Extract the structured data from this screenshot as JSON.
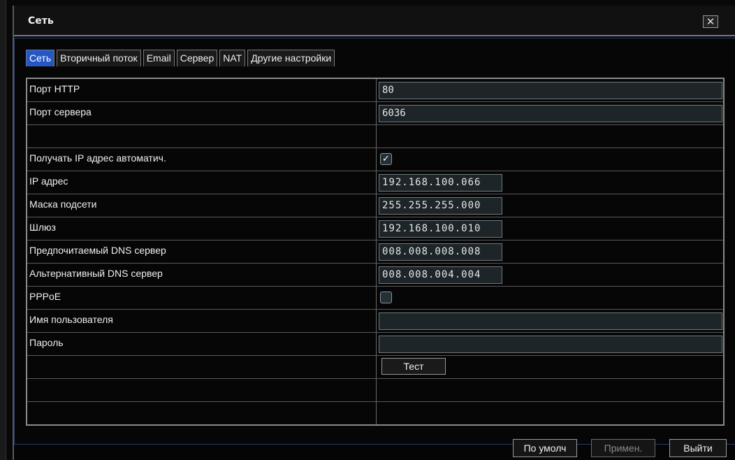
{
  "window": {
    "title": "Сеть",
    "close_icon": "close-icon"
  },
  "tabs": [
    {
      "label": "Сеть",
      "active": true
    },
    {
      "label": "Вторичный поток",
      "active": false
    },
    {
      "label": "Email",
      "active": false
    },
    {
      "label": "Сервер",
      "active": false
    },
    {
      "label": "NAT",
      "active": false
    },
    {
      "label": "Другие настройки",
      "active": false
    }
  ],
  "rows": {
    "http_port": {
      "label": "Порт HTTP",
      "value": "80"
    },
    "server_port": {
      "label": "Порт сервера",
      "value": "6036"
    },
    "dhcp": {
      "label": "Получать IP адрес автоматич.",
      "checked": true,
      "mark": "✓"
    },
    "ip": {
      "label": "IP адрес",
      "value": "192.168.100.066"
    },
    "mask": {
      "label": "Маска подсети",
      "value": "255.255.255.000"
    },
    "gateway": {
      "label": "Шлюз",
      "value": "192.168.100.010"
    },
    "dns1": {
      "label": "Предпочитаемый DNS сервер",
      "value": "008.008.008.008"
    },
    "dns2": {
      "label": "Альтернативный DNS сервер",
      "value": "008.008.004.004"
    },
    "pppoe": {
      "label": "PPPoE",
      "checked": false
    },
    "username": {
      "label": "Имя пользователя",
      "value": ""
    },
    "password": {
      "label": "Пароль",
      "value": ""
    },
    "test": {
      "label": "Тест"
    }
  },
  "footer": {
    "default_label": "По умолч",
    "apply_label": "Примен.",
    "exit_label": "Выйти"
  },
  "colors": {
    "active_tab": "#2457c5",
    "border_accent": "#1a3a8a"
  }
}
